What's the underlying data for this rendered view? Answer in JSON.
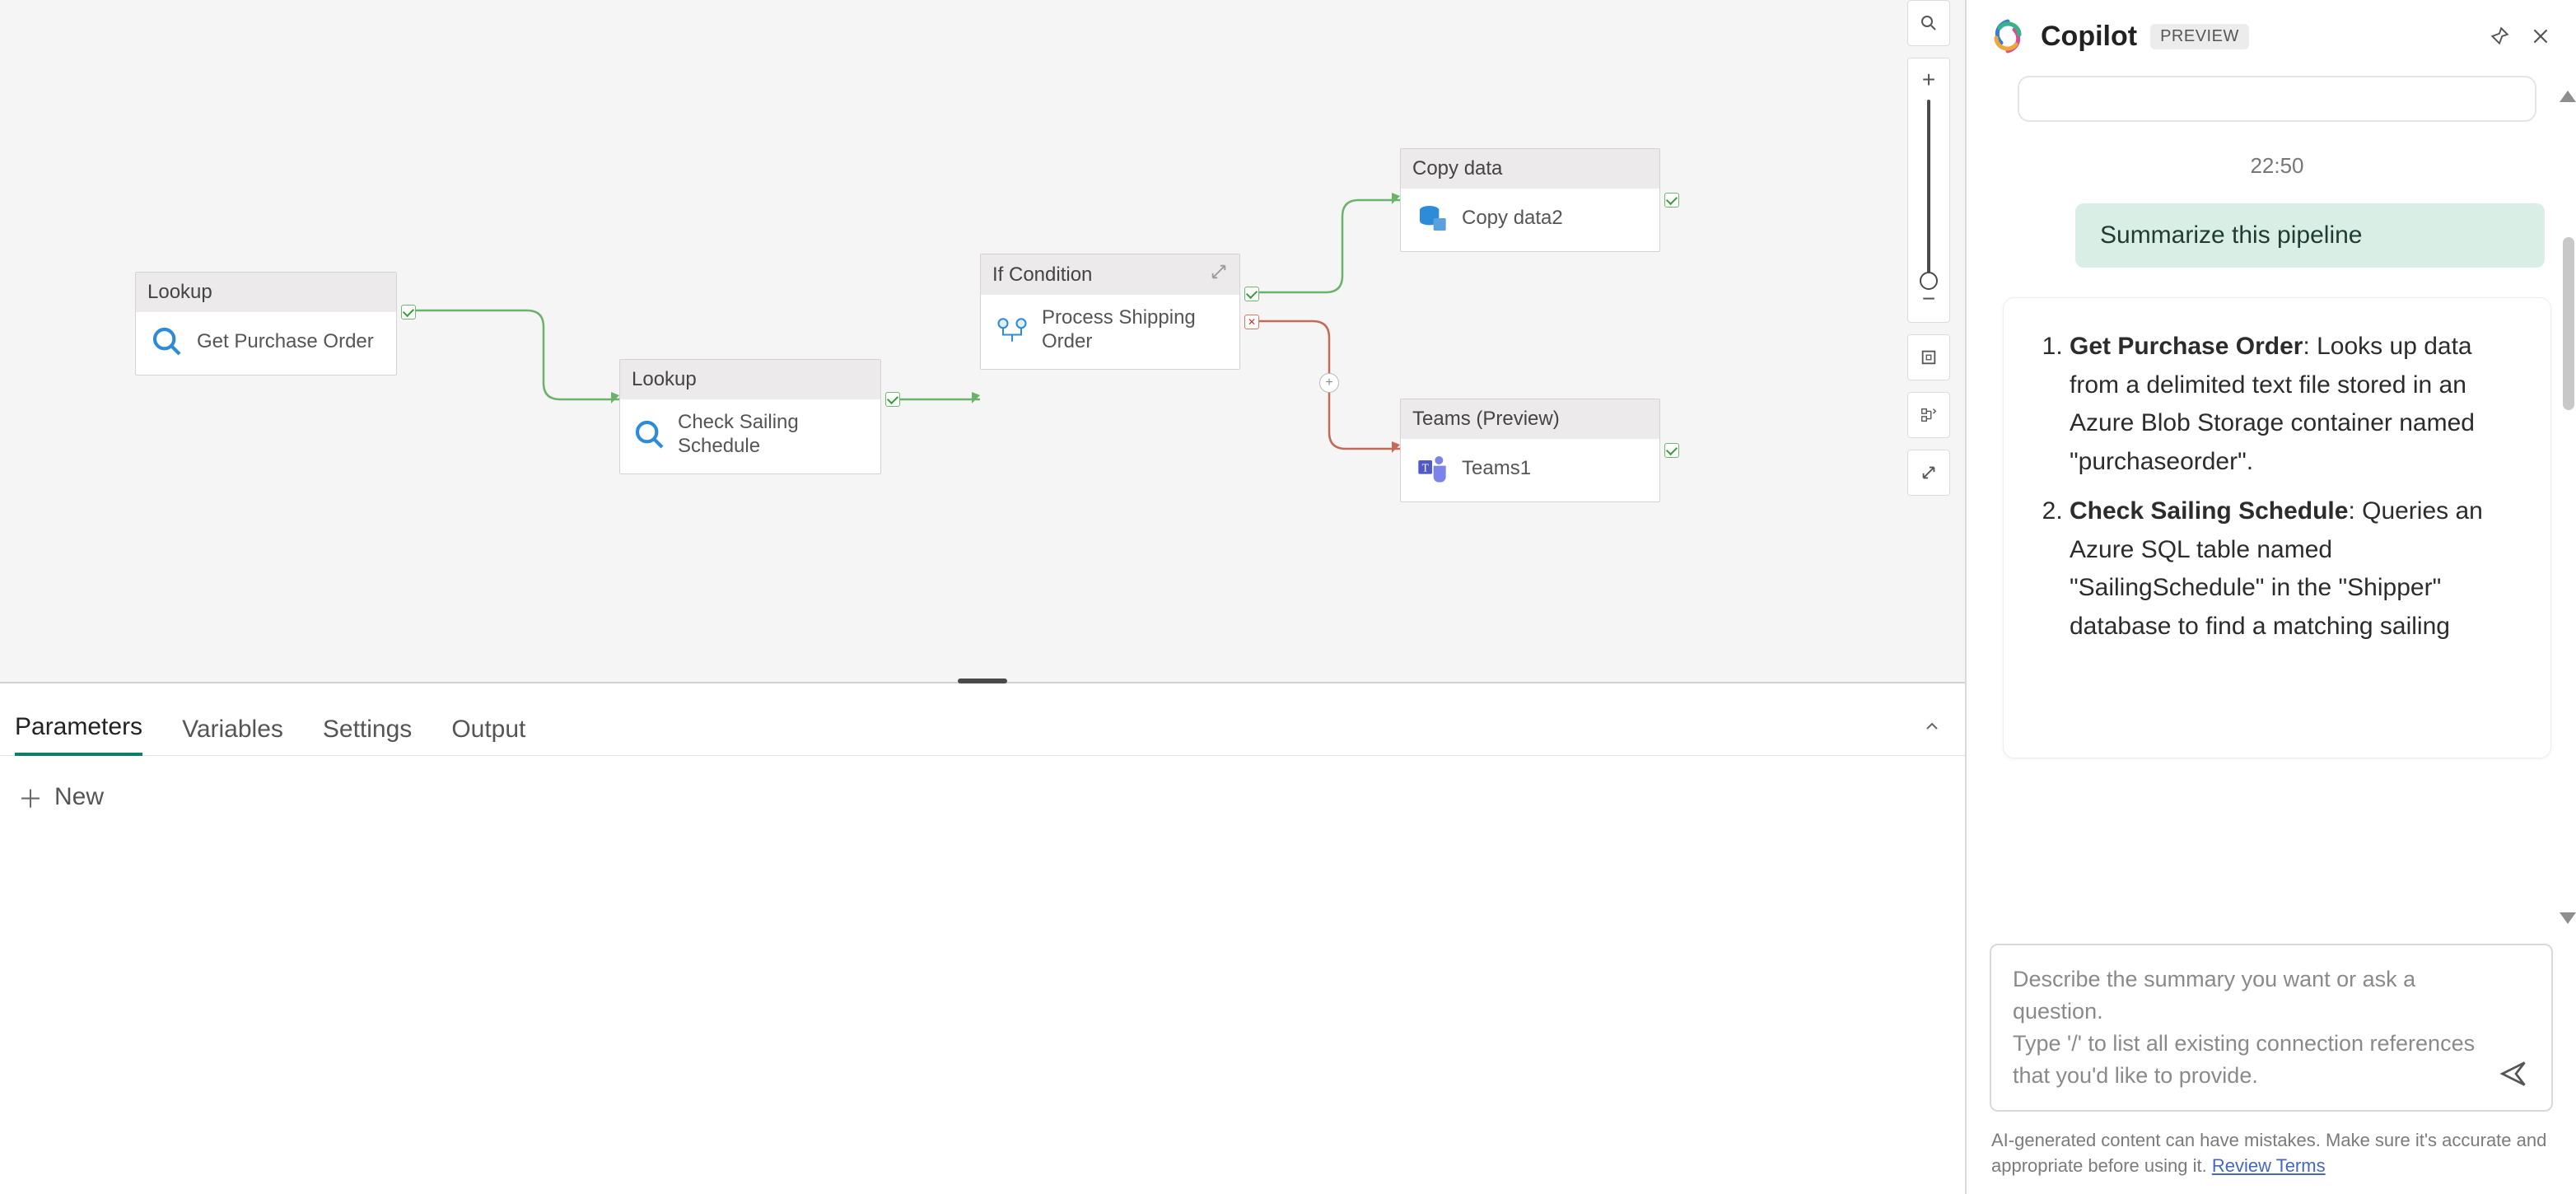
{
  "canvas": {
    "nodes": {
      "lookup1": {
        "type": "Lookup",
        "label": "Get Purchase Order"
      },
      "lookup2": {
        "type": "Lookup",
        "label": "Check Sailing Schedule"
      },
      "ifcond": {
        "type": "If Condition",
        "label": "Process Shipping Order"
      },
      "copy": {
        "type": "Copy data",
        "label": "Copy data2"
      },
      "teams": {
        "type": "Teams (Preview)",
        "label": "Teams1"
      }
    }
  },
  "bottomPanel": {
    "tabs": [
      "Parameters",
      "Variables",
      "Settings",
      "Output"
    ],
    "activeTab": "Parameters",
    "newLabel": "New"
  },
  "copilot": {
    "title": "Copilot",
    "badge": "PREVIEW",
    "timestamp": "22:50",
    "userMessage": "Summarize this pipeline",
    "response": {
      "items": [
        {
          "title": "Get Purchase Order",
          "body": ": Looks up data from a delimited text file stored in an Azure Blob Storage container named \"purchaseorder\"."
        },
        {
          "title": "Check Sailing Schedule",
          "body": ": Queries an Azure SQL table named \"SailingSchedule\" in the \"Shipper\" database to find a matching sailing"
        }
      ]
    },
    "input": {
      "placeholder1": "Describe the summary you want or ask a question.",
      "placeholder2": "Type '/' to list all existing connection references that you'd like to provide."
    },
    "disclaimer": "AI-generated content can have mistakes. Make sure it's accurate and appropriate before using it. ",
    "reviewTerms": "Review Terms"
  }
}
